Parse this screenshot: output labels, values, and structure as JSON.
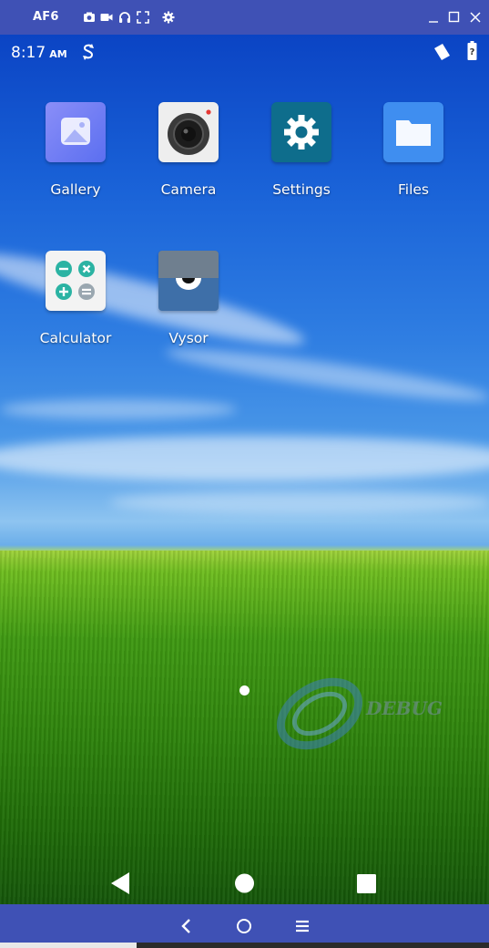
{
  "window": {
    "title": "AF6",
    "toolbar_icons": [
      "camera-icon",
      "video-icon",
      "headphones-icon",
      "fullscreen-icon",
      "settings-icon"
    ],
    "controls": [
      "minimize-icon",
      "maximize-icon",
      "close-icon"
    ]
  },
  "statusbar": {
    "time": "8:17",
    "ampm": "AM",
    "icons": [
      "sync-icon",
      "signal-icon",
      "battery-icon"
    ]
  },
  "apps": [
    {
      "label": "Gallery",
      "icon": "gallery-icon"
    },
    {
      "label": "Camera",
      "icon": "camera-icon"
    },
    {
      "label": "Settings",
      "icon": "gear-icon"
    },
    {
      "label": "Files",
      "icon": "folder-icon"
    },
    {
      "label": "Calculator",
      "icon": "calculator-icon"
    },
    {
      "label": "Vysor",
      "icon": "vysor-icon"
    }
  ],
  "watermark": {
    "text": "DEBUG"
  },
  "android_nav": [
    "back-icon",
    "home-icon",
    "recents-icon"
  ],
  "vysor_nav": [
    "back-icon",
    "home-icon",
    "menu-icon"
  ],
  "colors": {
    "vysor_bar": "#3f51b5",
    "settings_bg": "#0e6d8c"
  }
}
